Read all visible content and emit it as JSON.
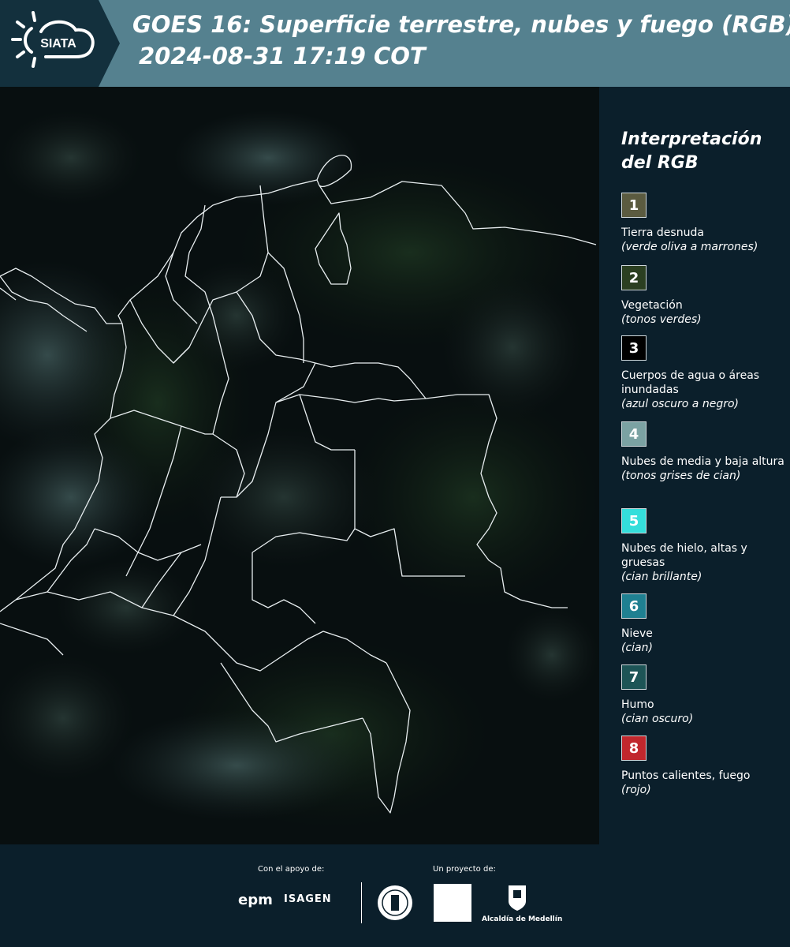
{
  "header": {
    "logo_text": "SIATA",
    "title_line1": "GOES 16: Superficie terrestre, nubes y fuego (RGB)",
    "title_line2": "2024-08-31 17:19 COT"
  },
  "legend": {
    "title": "Interpretación del RGB",
    "items": [
      {
        "num": "1",
        "label": "Tierra desnuda",
        "sub": "(verde oliva a marrones)",
        "color": "#5b5b40"
      },
      {
        "num": "2",
        "label": "Vegetación",
        "sub": "(tonos verdes)",
        "color": "#2b3f21"
      },
      {
        "num": "3",
        "label": "Cuerpos de agua o áreas inundadas",
        "sub": "(azul oscuro a negro)",
        "color": "#000000"
      },
      {
        "num": "4",
        "label": "Nubes de media y baja altura",
        "sub": "(tonos grises de cian)",
        "color": "#7ba2a3"
      },
      {
        "num": "5",
        "label": "Nubes de hielo, altas y gruesas",
        "sub": "(cian brillante)",
        "color": "#34dedb"
      },
      {
        "num": "6",
        "label": "Nieve",
        "sub": "(cian)",
        "color": "#1f8091"
      },
      {
        "num": "7",
        "label": "Humo",
        "sub": "(cian oscuro)",
        "color": "#1d5456"
      },
      {
        "num": "8",
        "label": "Puntos calientes, fuego",
        "sub": "(rojo)",
        "color": "#c1272d"
      }
    ]
  },
  "footer": {
    "support_label": "Con el apoyo de:",
    "project_label": "Un proyecto de:",
    "epm": "epm",
    "isagen": "ISAGEN",
    "alcaldia": "Alcaldía de Medellín"
  }
}
